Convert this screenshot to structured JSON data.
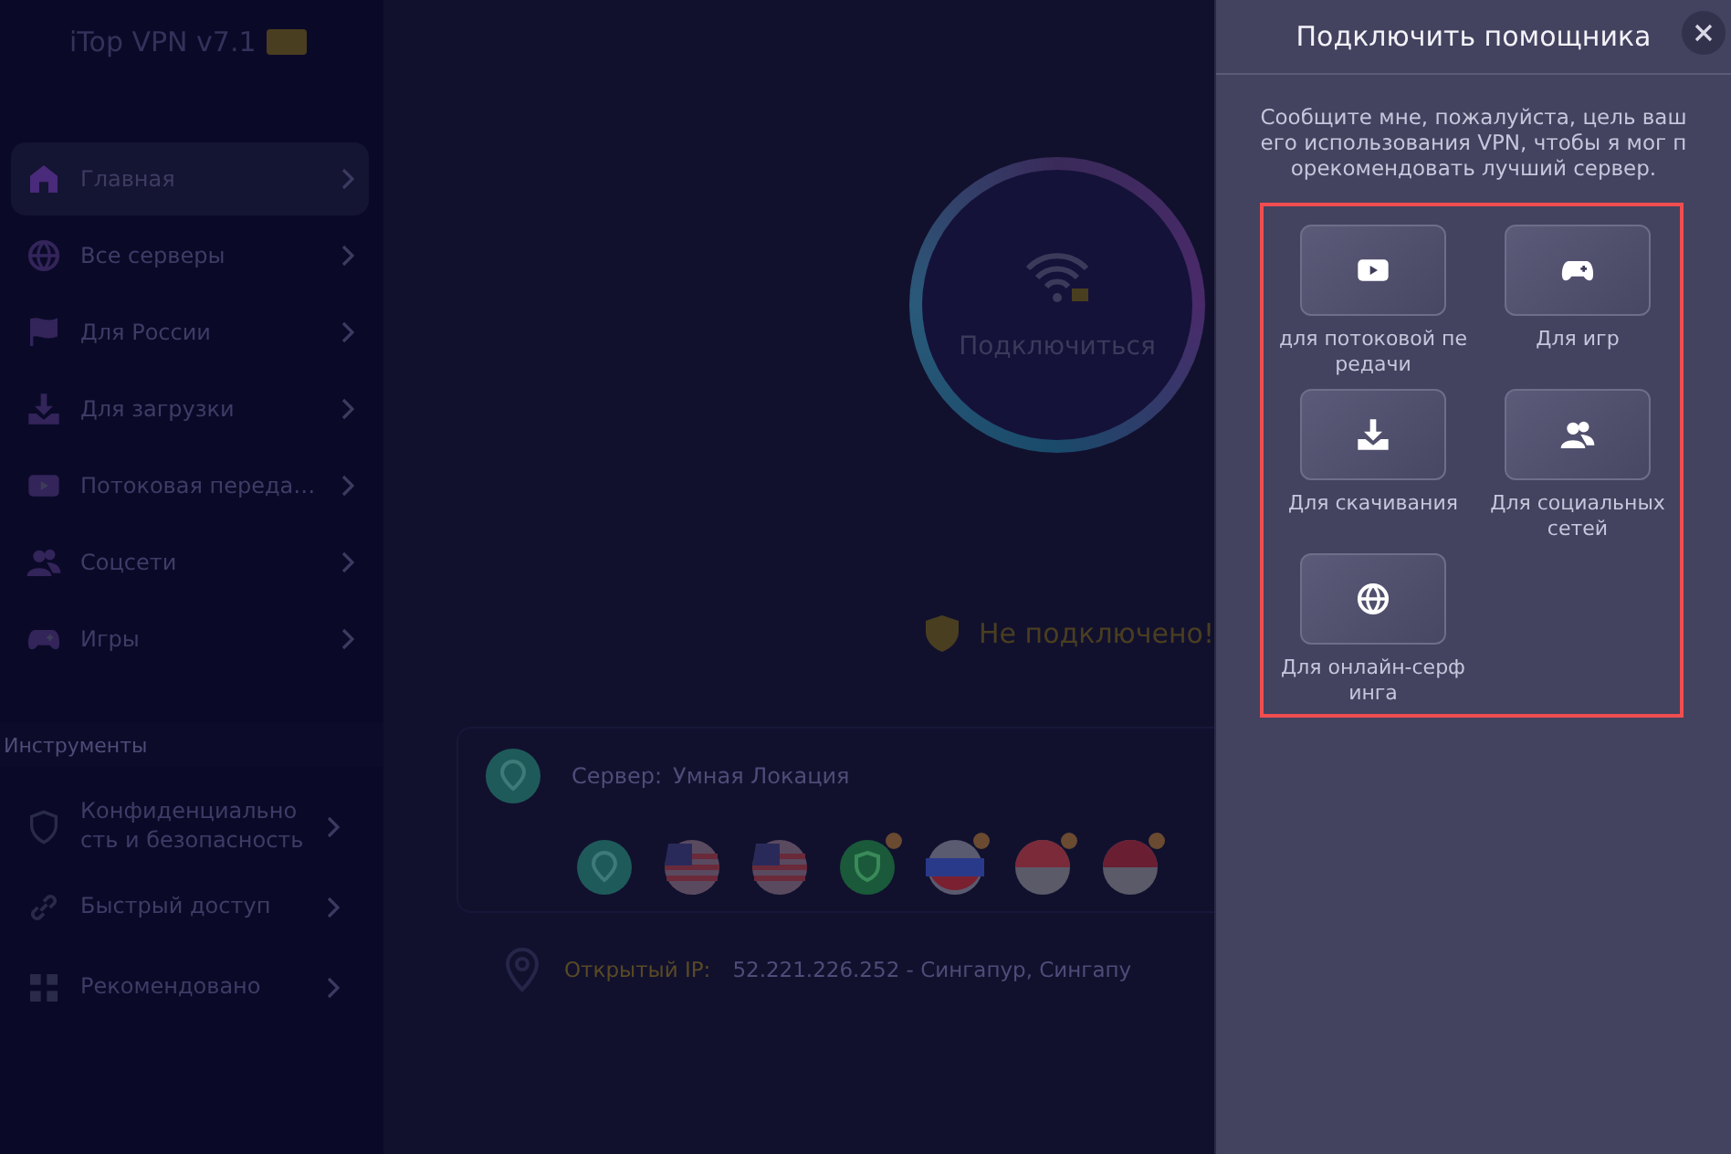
{
  "app": {
    "title": "iTop VPN v7.1"
  },
  "sidebar": {
    "items": [
      {
        "label": "Главная",
        "selected": true
      },
      {
        "label": "Все серверы",
        "selected": false
      },
      {
        "label": "Для России",
        "selected": false
      },
      {
        "label": "Для загрузки",
        "selected": false
      },
      {
        "label": "Потоковая переда…",
        "selected": false
      },
      {
        "label": "Соцсети",
        "selected": false
      },
      {
        "label": "Игры",
        "selected": false
      }
    ],
    "section_title": "Инструменты",
    "tools": [
      {
        "label": "Конфиденциальность и безопасность"
      },
      {
        "label": "Быстрый доступ"
      },
      {
        "label": "Рекомендовано"
      }
    ]
  },
  "connect": {
    "label": "Подключиться",
    "status": "Не подключено!"
  },
  "server": {
    "label": "Сервер:",
    "value": "Умная Локация",
    "flags": [
      {
        "badge": false
      },
      {
        "badge": false
      },
      {
        "badge": false
      },
      {
        "badge": true
      },
      {
        "badge": true
      },
      {
        "badge": true
      },
      {
        "badge": true
      }
    ]
  },
  "ip": {
    "label": "Открытый IP:",
    "value": "52.221.226.252 - Сингапур, Сингапу"
  },
  "assistant": {
    "title": "Подключить помощника",
    "description": "Сообщите мне, пожалуйста, цель вашего использования VPN, чтобы я мог порекомендовать лучший сервер.",
    "options": [
      {
        "label": "для потоковой передачи"
      },
      {
        "label": "Для игр"
      },
      {
        "label": "Для скачивания"
      },
      {
        "label": "Для социальных сетей"
      },
      {
        "label": "Для онлайн-серфинга"
      }
    ]
  }
}
